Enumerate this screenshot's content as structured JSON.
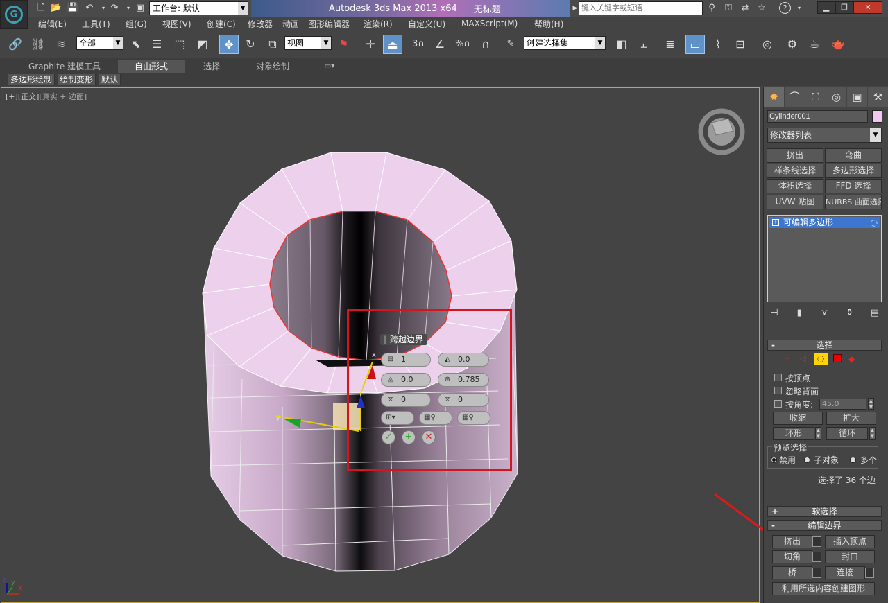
{
  "titlebar": {
    "workspace_label": "工作台: 默认",
    "app_title": "Autodesk 3ds Max  2013 x64",
    "doc_title": "无标题",
    "search_placeholder": "键入关键字或短语"
  },
  "menu": [
    "编辑(E)",
    "工具(T)",
    "组(G)",
    "视图(V)",
    "创建(C)",
    "修改器",
    "动画",
    "图形编辑器",
    "渲染(R)",
    "自定义(U)",
    "MAXScript(M)",
    "帮助(H)"
  ],
  "toolbar": {
    "selection_filter": "全部",
    "ref_coord": "视图",
    "named_selection": "创建选择集",
    "snap_label": "3",
    "percent_label": "%"
  },
  "ribbon": {
    "tabs": [
      "Graphite 建模工具",
      "自由形式",
      "选择",
      "对象绘制"
    ],
    "subtabs": [
      "多边形绘制",
      "绘制变形",
      "默认"
    ]
  },
  "viewport": {
    "label_plus": "[+]",
    "label_view": "[正交]",
    "label_shading": "[真实 + 边面]",
    "axes": {
      "x": "x",
      "y": "y",
      "z": "z"
    }
  },
  "caddy": {
    "title": "跨越边界",
    "fields": [
      "1",
      "0.0",
      "0.0",
      "0.785",
      "0",
      "0"
    ]
  },
  "panel": {
    "object_name": "Cylinder001",
    "object_color": "#f0c8f0",
    "modifier_list": "修改器列表",
    "modifier_buttons": [
      "挤出",
      "弯曲",
      "样条线选择",
      "多边形选择",
      "体积选择",
      "FFD 选择",
      "UVW 贴图",
      "NURBS 曲面选择"
    ],
    "stack_item": "可编辑多边形",
    "selection": {
      "header": "选择",
      "by_vertex": "按顶点",
      "ignore_backfacing": "忽略背面",
      "by_angle": "按角度:",
      "angle_value": "45.0",
      "shrink": "收缩",
      "grow": "扩大",
      "ring": "环形",
      "loop": "循环",
      "preview_label": "预览选择",
      "preview_options": [
        "禁用",
        "子对象",
        "多个"
      ],
      "status": "选择了 36 个边"
    },
    "soft_selection": "软选择",
    "edit_edges": {
      "header": "编辑边界",
      "extrude": "挤出",
      "insert_vertex": "插入顶点",
      "chamfer": "切角",
      "cap": "封口",
      "bridge": "桥",
      "connect": "连接",
      "create_shape": "利用所选内容创建图形"
    }
  }
}
